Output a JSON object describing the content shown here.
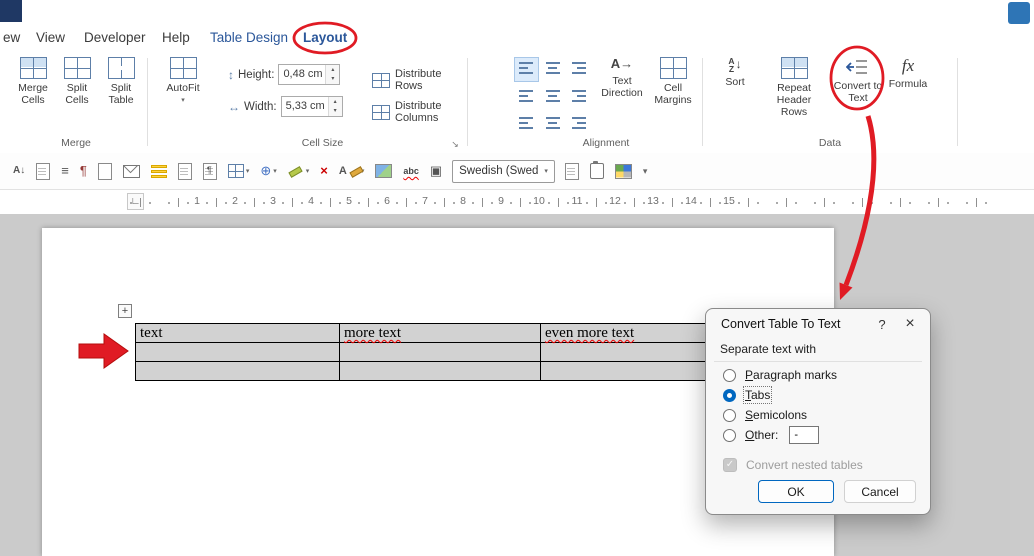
{
  "window": {
    "menu": [
      "ew",
      "View",
      "Developer",
      "Help",
      "Table Design",
      "Layout"
    ]
  },
  "ribbon": {
    "merge_group": {
      "label": "Merge",
      "merge_cells": "Merge Cells",
      "split_cells": "Split Cells",
      "split_table": "Split Table"
    },
    "cell_size_group": {
      "label": "Cell Size",
      "autofit": "AutoFit",
      "height_label": "Height:",
      "height_value": "0,48 cm",
      "width_label": "Width:",
      "width_value": "5,33 cm",
      "distribute_rows": "Distribute Rows",
      "distribute_columns": "Distribute Columns"
    },
    "alignment_group": {
      "label": "Alignment",
      "text_direction": "Text Direction",
      "cell_margins": "Cell Margins"
    },
    "data_group": {
      "label": "Data",
      "sort": "Sort",
      "repeat_header_rows": "Repeat Header Rows",
      "convert_to_text": "Convert to Text",
      "formula": "Formula"
    }
  },
  "toolbar": {
    "language": "Swedish (Swed",
    "spell_sample": "abc"
  },
  "ruler": {
    "numbers": [
      "1",
      "2",
      "3",
      "4",
      "5",
      "6",
      "7",
      "8",
      "9",
      "10",
      "11",
      "12",
      "13",
      "14",
      "15"
    ]
  },
  "document": {
    "table": {
      "rows": [
        [
          {
            "text": "text",
            "misspelled": false
          },
          {
            "text": "more text",
            "misspelled": true
          },
          {
            "text": "even more text",
            "misspelled": true
          }
        ],
        [
          {
            "text": "",
            "misspelled": false
          },
          {
            "text": "",
            "misspelled": false
          },
          {
            "text": "",
            "misspelled": false
          }
        ],
        [
          {
            "text": "",
            "misspelled": false
          },
          {
            "text": "",
            "misspelled": false
          },
          {
            "text": "",
            "misspelled": false
          }
        ]
      ]
    }
  },
  "dialog": {
    "title": "Convert Table To Text",
    "help_glyph": "?",
    "close_glyph": "×",
    "separator_label": "Separate text with",
    "options": [
      {
        "label": "Paragraph marks",
        "selected": false
      },
      {
        "label": "Tabs",
        "selected": true
      },
      {
        "label": "Semicolons",
        "selected": false
      },
      {
        "label": "Other:",
        "selected": false
      }
    ],
    "other_value": "-",
    "nested_checkbox": {
      "label": "Convert nested tables",
      "checked": true,
      "disabled": true
    },
    "check_glyph": "✓",
    "ok_label": "OK",
    "cancel_label": "Cancel"
  },
  "icons": {
    "caret": "▾",
    "spin_up": "▴",
    "spin_down": "▾",
    "height_glyph": "↕",
    "width_glyph": "↔",
    "text_direction_glyph": "A→",
    "sort_a": "A",
    "sort_z": "Z",
    "sort_arrow": "↓",
    "formula_glyph": "fx",
    "dialog_launcher_glyph": "↘",
    "tab_selector_glyph": "∟",
    "handle_glyph": "+",
    "toolbar_glyphs": {
      "sort": "A↓",
      "list": "≡",
      "pilcrow": "¶",
      "globe": "⊕",
      "delete": "×",
      "font": "A",
      "framed": "▣",
      "overflow": "▾",
      "page_pilcrow": "¶"
    }
  },
  "accent_colors": {
    "red_annotation": "#e01b24",
    "tab_blue": "#2b579a",
    "radio_blue": "#0067c0"
  }
}
